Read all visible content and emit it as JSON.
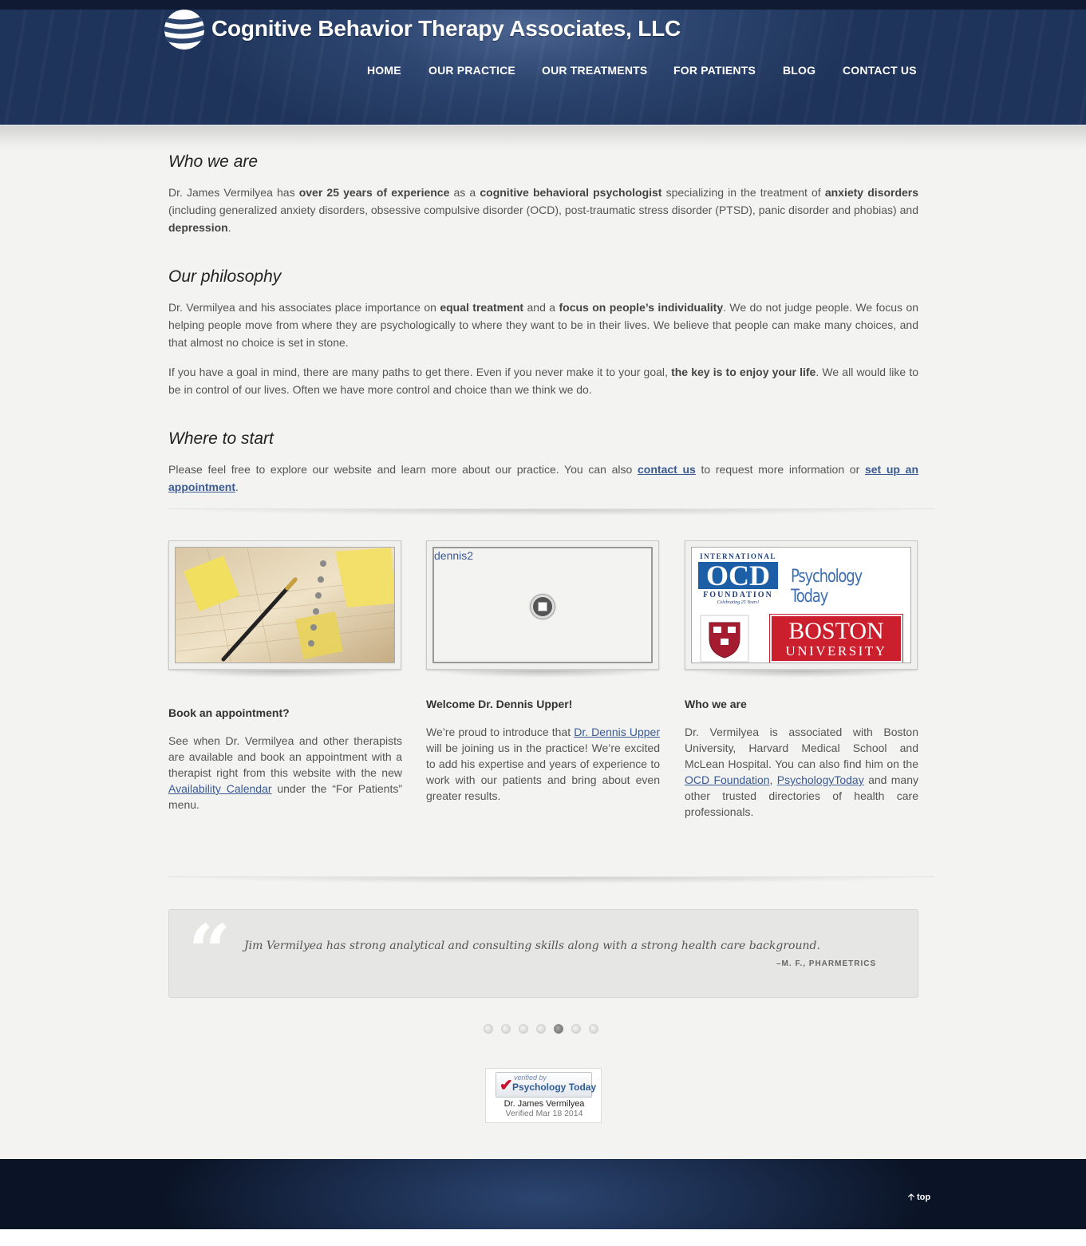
{
  "header": {
    "site_title": "Cognitive Behavior Therapy Associates, LLC",
    "nav": [
      {
        "label": "HOME"
      },
      {
        "label": "OUR PRACTICE"
      },
      {
        "label": "OUR TREATMENTS"
      },
      {
        "label": "FOR PATIENTS"
      },
      {
        "label": "BLOG"
      },
      {
        "label": "CONTACT US"
      }
    ]
  },
  "who_we_are": {
    "heading": "Who we are",
    "t1": "Dr. James Vermilyea has ",
    "b1": "over 25 years of experience",
    "t2": " as a ",
    "b2": "cognitive behavioral psychologist",
    "t3": " specializing in the treatment of ",
    "b3": "anxiety disorders",
    "t4": " (including generalized anxiety disorders, obsessive compulsive disorder (OCD), post-traumatic stress disorder (PTSD), panic disorder and phobias) and ",
    "b4": "depression",
    "t5": "."
  },
  "philosophy": {
    "heading": "Our philosophy",
    "p1_t1": "Dr. Vermilyea and his associates place importance on ",
    "p1_b1": "equal treatment",
    "p1_t2": " and a ",
    "p1_b2": "focus on people’s individuality",
    "p1_t3": ". We do not judge people. We focus on helping people move from where they are psychologically to where they want to be in their lives. We believe that people can make many choices, and that almost no choice is set in stone.",
    "p2_t1": "If you have a goal in mind, there are many paths to get there. Even if you never make it to your goal, ",
    "p2_b1": "the key is to enjoy your life",
    "p2_t2": ". We all would like to be in control of our lives. Often we have more control and choice than we think we do."
  },
  "where_to_start": {
    "heading": "Where to start",
    "t1": "Please feel free to explore our website and learn more about our practice. You can also ",
    "link1": "contact us",
    "t2": " to request more information or ",
    "link2": "set up an appointment",
    "t3": "."
  },
  "features": [
    {
      "title": "Book an appointment?",
      "t1": "See when Dr. Vermilyea and other therapists are available and book an appointment with a therapist right from this website with the new ",
      "link": "Availability Calendar",
      "t2": " under the “For Patients” menu."
    },
    {
      "title": "Welcome Dr. Dennis Upper!",
      "image_alt": "dennis2",
      "t1": "We’re proud to introduce that ",
      "link": "Dr. Dennis Upper",
      "t2": " will be joining us in the practice! We’re excited to add his expertise and years of experience to work with our patients and bring about even greater results."
    },
    {
      "title": "Who we are",
      "t1": "Dr. Vermilyea is associated with Boston University, Harvard Medical School and McLean Hospital. You can also find him on the ",
      "link1": "OCD Foundation",
      "t2": ", ",
      "link2": "PsychologyToday",
      "t3": " and many other trusted directories of health care professionals.",
      "logos": {
        "ocd_top": "INTERNATIONAL",
        "ocd_main": "OCD",
        "ocd_bottom": "FOUNDATION",
        "ocd_tag": "Celebrating 25 Years!",
        "pt": "Psychology Today",
        "bu1": "BOSTON",
        "bu2": "UNIVERSITY"
      }
    }
  ],
  "testimonial": {
    "quote_mark": "“",
    "text": "Jim Vermilyea has strong analytical and consulting skills along with a strong health care background.",
    "author": "–M. F., PHARMETRICS",
    "active_dot": 5
  },
  "badge": {
    "verified": "verified by",
    "brand": "Psychology Today",
    "name": "Dr. James Vermilyea",
    "date": "Verified Mar 18 2014"
  },
  "footer": {
    "top_link": "top",
    "top_icon": "arrow-up-icon"
  },
  "colors": {
    "header": "#2d4670",
    "link": "#3a5a93",
    "background": "#f3f3f1",
    "bu_red": "#cc1f2e"
  }
}
